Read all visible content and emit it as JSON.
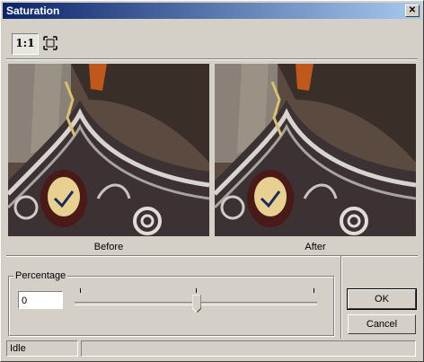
{
  "window": {
    "title": "Saturation"
  },
  "toolbar": {
    "actual_size_label": "1:1",
    "fit_icon": "fit-to-window-icon"
  },
  "previews": {
    "before_label": "Before",
    "after_label": "After"
  },
  "adjustment": {
    "group_label": "Percentage",
    "value": "0",
    "slider_fraction": 0.5
  },
  "buttons": {
    "ok_label": "OK",
    "cancel_label": "Cancel"
  },
  "status": {
    "text": "Idle",
    "secondary": ""
  }
}
